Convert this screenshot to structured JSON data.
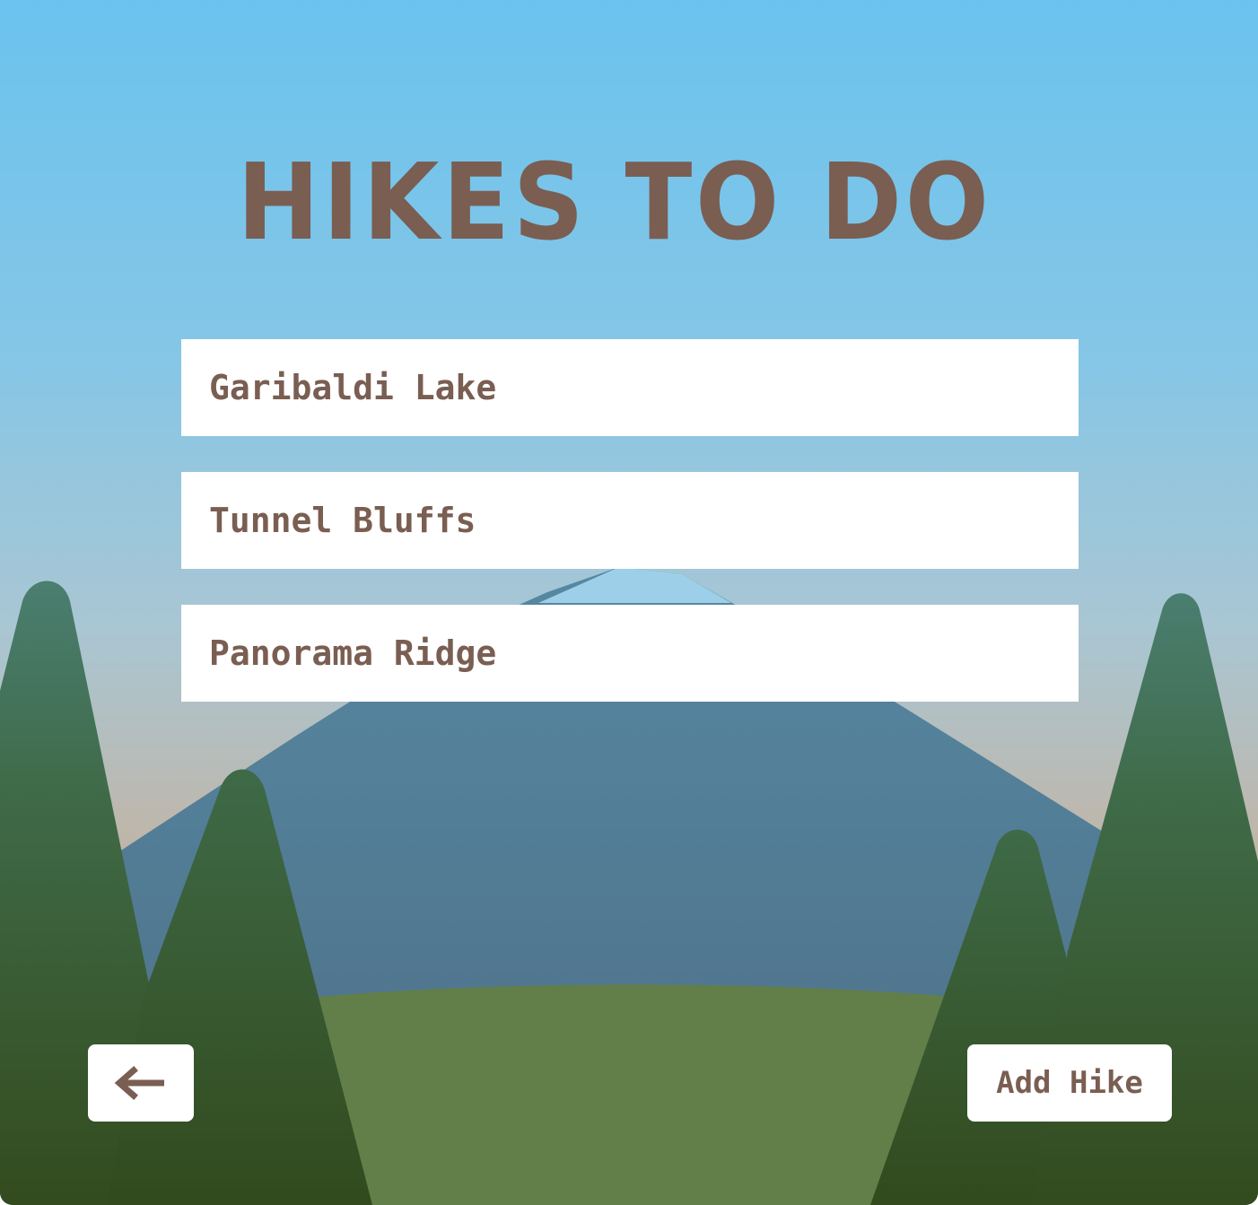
{
  "app": {
    "title": "HIKES TO DO"
  },
  "hikes": [
    {
      "name": "Garibaldi Lake"
    },
    {
      "name": "Tunnel Bluffs"
    },
    {
      "name": "Panorama Ridge"
    }
  ],
  "buttons": {
    "back_icon": "left-arrow-icon",
    "add_label": "Add Hike"
  },
  "colors": {
    "accent_text": "#7a5e52",
    "sky_top": "#6ac3ee",
    "mountain": "#4f7892",
    "meadow": "#627f4a",
    "tree_dark": "#344f1f",
    "tree_light": "#4a7e70"
  }
}
